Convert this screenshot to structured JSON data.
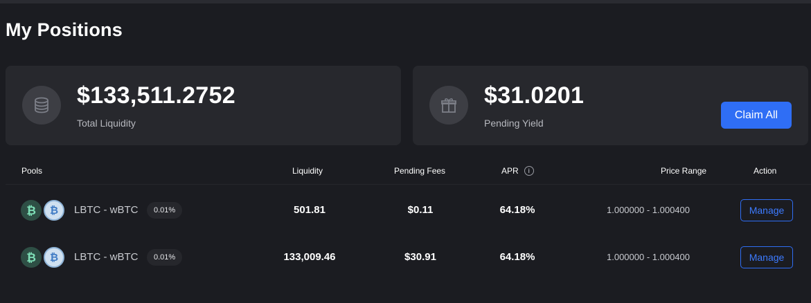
{
  "page": {
    "title": "My Positions"
  },
  "summary": {
    "liquidity": {
      "value": "$133,511.2752",
      "label": "Total Liquidity",
      "icon": "database-icon"
    },
    "yield": {
      "value": "$31.0201",
      "label": "Pending Yield",
      "icon": "gift-icon",
      "claim_label": "Claim All"
    }
  },
  "table": {
    "headers": {
      "pools": "Pools",
      "liquidity": "Liquidity",
      "pending_fees": "Pending Fees",
      "apr": "APR",
      "price_range": "Price Range",
      "action": "Action"
    },
    "rows": [
      {
        "pair": "LBTC - wBTC",
        "fee_tier": "0.01%",
        "liquidity": "501.81",
        "pending_fees": "$0.11",
        "apr": "64.18%",
        "price_range": "1.000000 - 1.000400",
        "action": "Manage"
      },
      {
        "pair": "LBTC - wBTC",
        "fee_tier": "0.01%",
        "liquidity": "133,009.46",
        "pending_fees": "$30.91",
        "apr": "64.18%",
        "price_range": "1.000000 - 1.000400",
        "action": "Manage"
      }
    ]
  },
  "colors": {
    "background": "#1b1c21",
    "card": "#27282d",
    "accent": "#2f6ef5",
    "lbtc_coin": "#2e4f45",
    "wbtc_coin": "#cfe0f0"
  }
}
